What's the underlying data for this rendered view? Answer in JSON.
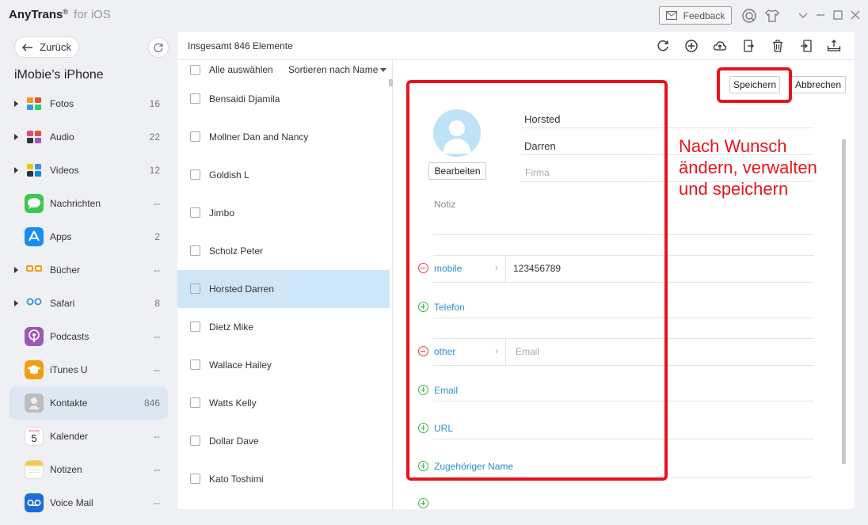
{
  "app": {
    "name": "AnyTrans",
    "reg": "®",
    "suffix": "for iOS"
  },
  "titlebar": {
    "feedback_label": "Feedback"
  },
  "sidebar": {
    "back_label": "Zurück",
    "device_name": "iMobie’s iPhone",
    "items": [
      {
        "label": "Fotos",
        "count": "16",
        "caret": true,
        "icon": "photos-icon"
      },
      {
        "label": "Audio",
        "count": "22",
        "caret": true,
        "icon": "audio-icon"
      },
      {
        "label": "Videos",
        "count": "12",
        "caret": true,
        "icon": "videos-icon"
      },
      {
        "label": "Nachrichten",
        "count": "--",
        "caret": false,
        "icon": "messages-icon"
      },
      {
        "label": "Apps",
        "count": "2",
        "caret": false,
        "icon": "apps-icon"
      },
      {
        "label": "Bücher",
        "count": "--",
        "caret": true,
        "icon": "books-icon"
      },
      {
        "label": "Safari",
        "count": "8",
        "caret": true,
        "icon": "safari-icon"
      },
      {
        "label": "Podcasts",
        "count": "--",
        "caret": false,
        "icon": "podcasts-icon"
      },
      {
        "label": "iTunes U",
        "count": "--",
        "caret": false,
        "icon": "itunes-u-icon"
      },
      {
        "label": "Kontakte",
        "count": "846",
        "caret": false,
        "icon": "contacts-icon",
        "active": true
      },
      {
        "label": "Kalender",
        "count": "--",
        "caret": false,
        "icon": "calendar-icon",
        "icon_text_top": "Monday",
        "icon_text": "5"
      },
      {
        "label": "Notizen",
        "count": "--",
        "caret": false,
        "icon": "notes-icon"
      },
      {
        "label": "Voice Mail",
        "count": "--",
        "caret": false,
        "icon": "voicemail-icon"
      }
    ]
  },
  "main": {
    "total_label": "Insgesamt 846 Elemente",
    "list": {
      "select_all": "Alle auswählen",
      "sort_label": "Sortieren nach Name",
      "rows": [
        {
          "name": "Bensaidi Djamila"
        },
        {
          "name": "Mollner Dan and Nancy"
        },
        {
          "name": "Goldish L"
        },
        {
          "name": "Jimbo"
        },
        {
          "name": "Scholz Peter"
        },
        {
          "name": "Horsted Darren",
          "active": true
        },
        {
          "name": "Dietz Mike"
        },
        {
          "name": "Wallace Hailey"
        },
        {
          "name": "Watts Kelly"
        },
        {
          "name": "Dollar Dave"
        },
        {
          "name": "Kato Toshimi"
        }
      ]
    },
    "detail": {
      "save_label": "Speichern",
      "cancel_label": "Abbrechen",
      "edit_label": "Bearbeiten",
      "last_name": "Horsted",
      "first_name": "Darren",
      "company_placeholder": "Firma",
      "note_label": "Notiz",
      "phone1_label": "mobile",
      "phone1_value": "123456789",
      "phone_add_label": "Telefon",
      "email1_label": "other",
      "email1_placeholder": "Email",
      "email_add_label": "Email",
      "url_add_label": "URL",
      "related_add_label": "Zugehöriger Name"
    }
  },
  "annotation": {
    "line1": "Nach Wunsch",
    "line2": "ändern, verwalten",
    "line3": "und speichern",
    "color": "#e8141c"
  }
}
